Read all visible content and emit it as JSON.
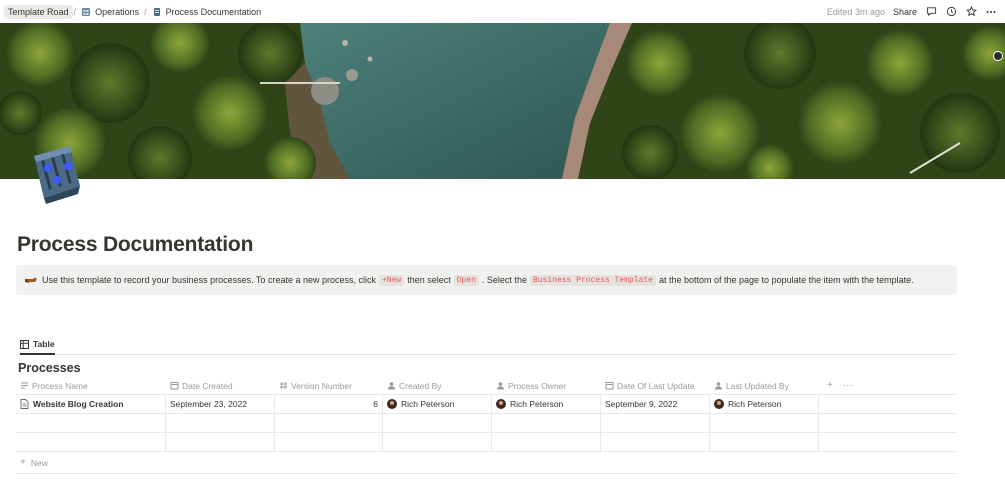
{
  "topbar": {
    "breadcrumbs": [
      {
        "label": "Template Road",
        "icon": "none"
      },
      {
        "label": "Operations",
        "icon": "building-icon"
      },
      {
        "label": "Process Documentation",
        "icon": "page-icon"
      }
    ],
    "separator": "/",
    "edited": "Edited 3m ago",
    "share": "Share",
    "icons": [
      "comment-icon",
      "clock-icon",
      "star-icon",
      "more-icon"
    ]
  },
  "cover": {
    "description_colors": {
      "water": "#3f6f6a",
      "forest": "#4c6a2a"
    }
  },
  "page": {
    "title": "Process Documentation",
    "icon": "sliders-icon"
  },
  "callout": {
    "emoji": "pointing-hand-icon",
    "text_1": "Use this template to record your business processes. To create a new process, click",
    "code_1": "+New",
    "text_2": "then select",
    "code_2": "Open",
    "text_3": ". Select the",
    "code_3": "Business Process Template",
    "text_4": "at the bottom of the page to populate the item with the template."
  },
  "view": {
    "tab_label": "Table",
    "tab_icon": "table-icon"
  },
  "database": {
    "title": "Processes",
    "columns": [
      {
        "label": "Process Name",
        "icon": "text-icon"
      },
      {
        "label": "Date Created",
        "icon": "calendar-icon"
      },
      {
        "label": "Version Number",
        "icon": "hash-icon"
      },
      {
        "label": "Created By",
        "icon": "person-icon"
      },
      {
        "label": "Process Owner",
        "icon": "person-icon"
      },
      {
        "label": "Date Of Last Update",
        "icon": "calendar-icon"
      },
      {
        "label": "Last Updated By",
        "icon": "person-icon"
      }
    ],
    "rows": [
      {
        "name": "Website Blog Creation",
        "date_created": "September 23, 2022",
        "version": "6",
        "created_by": "Rich Peterson",
        "owner": "Rich Peterson",
        "last_update": "September 9, 2022",
        "last_updated_by": "Rich Peterson"
      }
    ],
    "new_label": "New",
    "add_column": "+",
    "more": "···"
  },
  "colors": {
    "text": "#37352f",
    "muted": "#9b9a97",
    "callout_bg": "#f1f1ef",
    "code_text": "#eb5757",
    "border": "#e9e9e7"
  }
}
